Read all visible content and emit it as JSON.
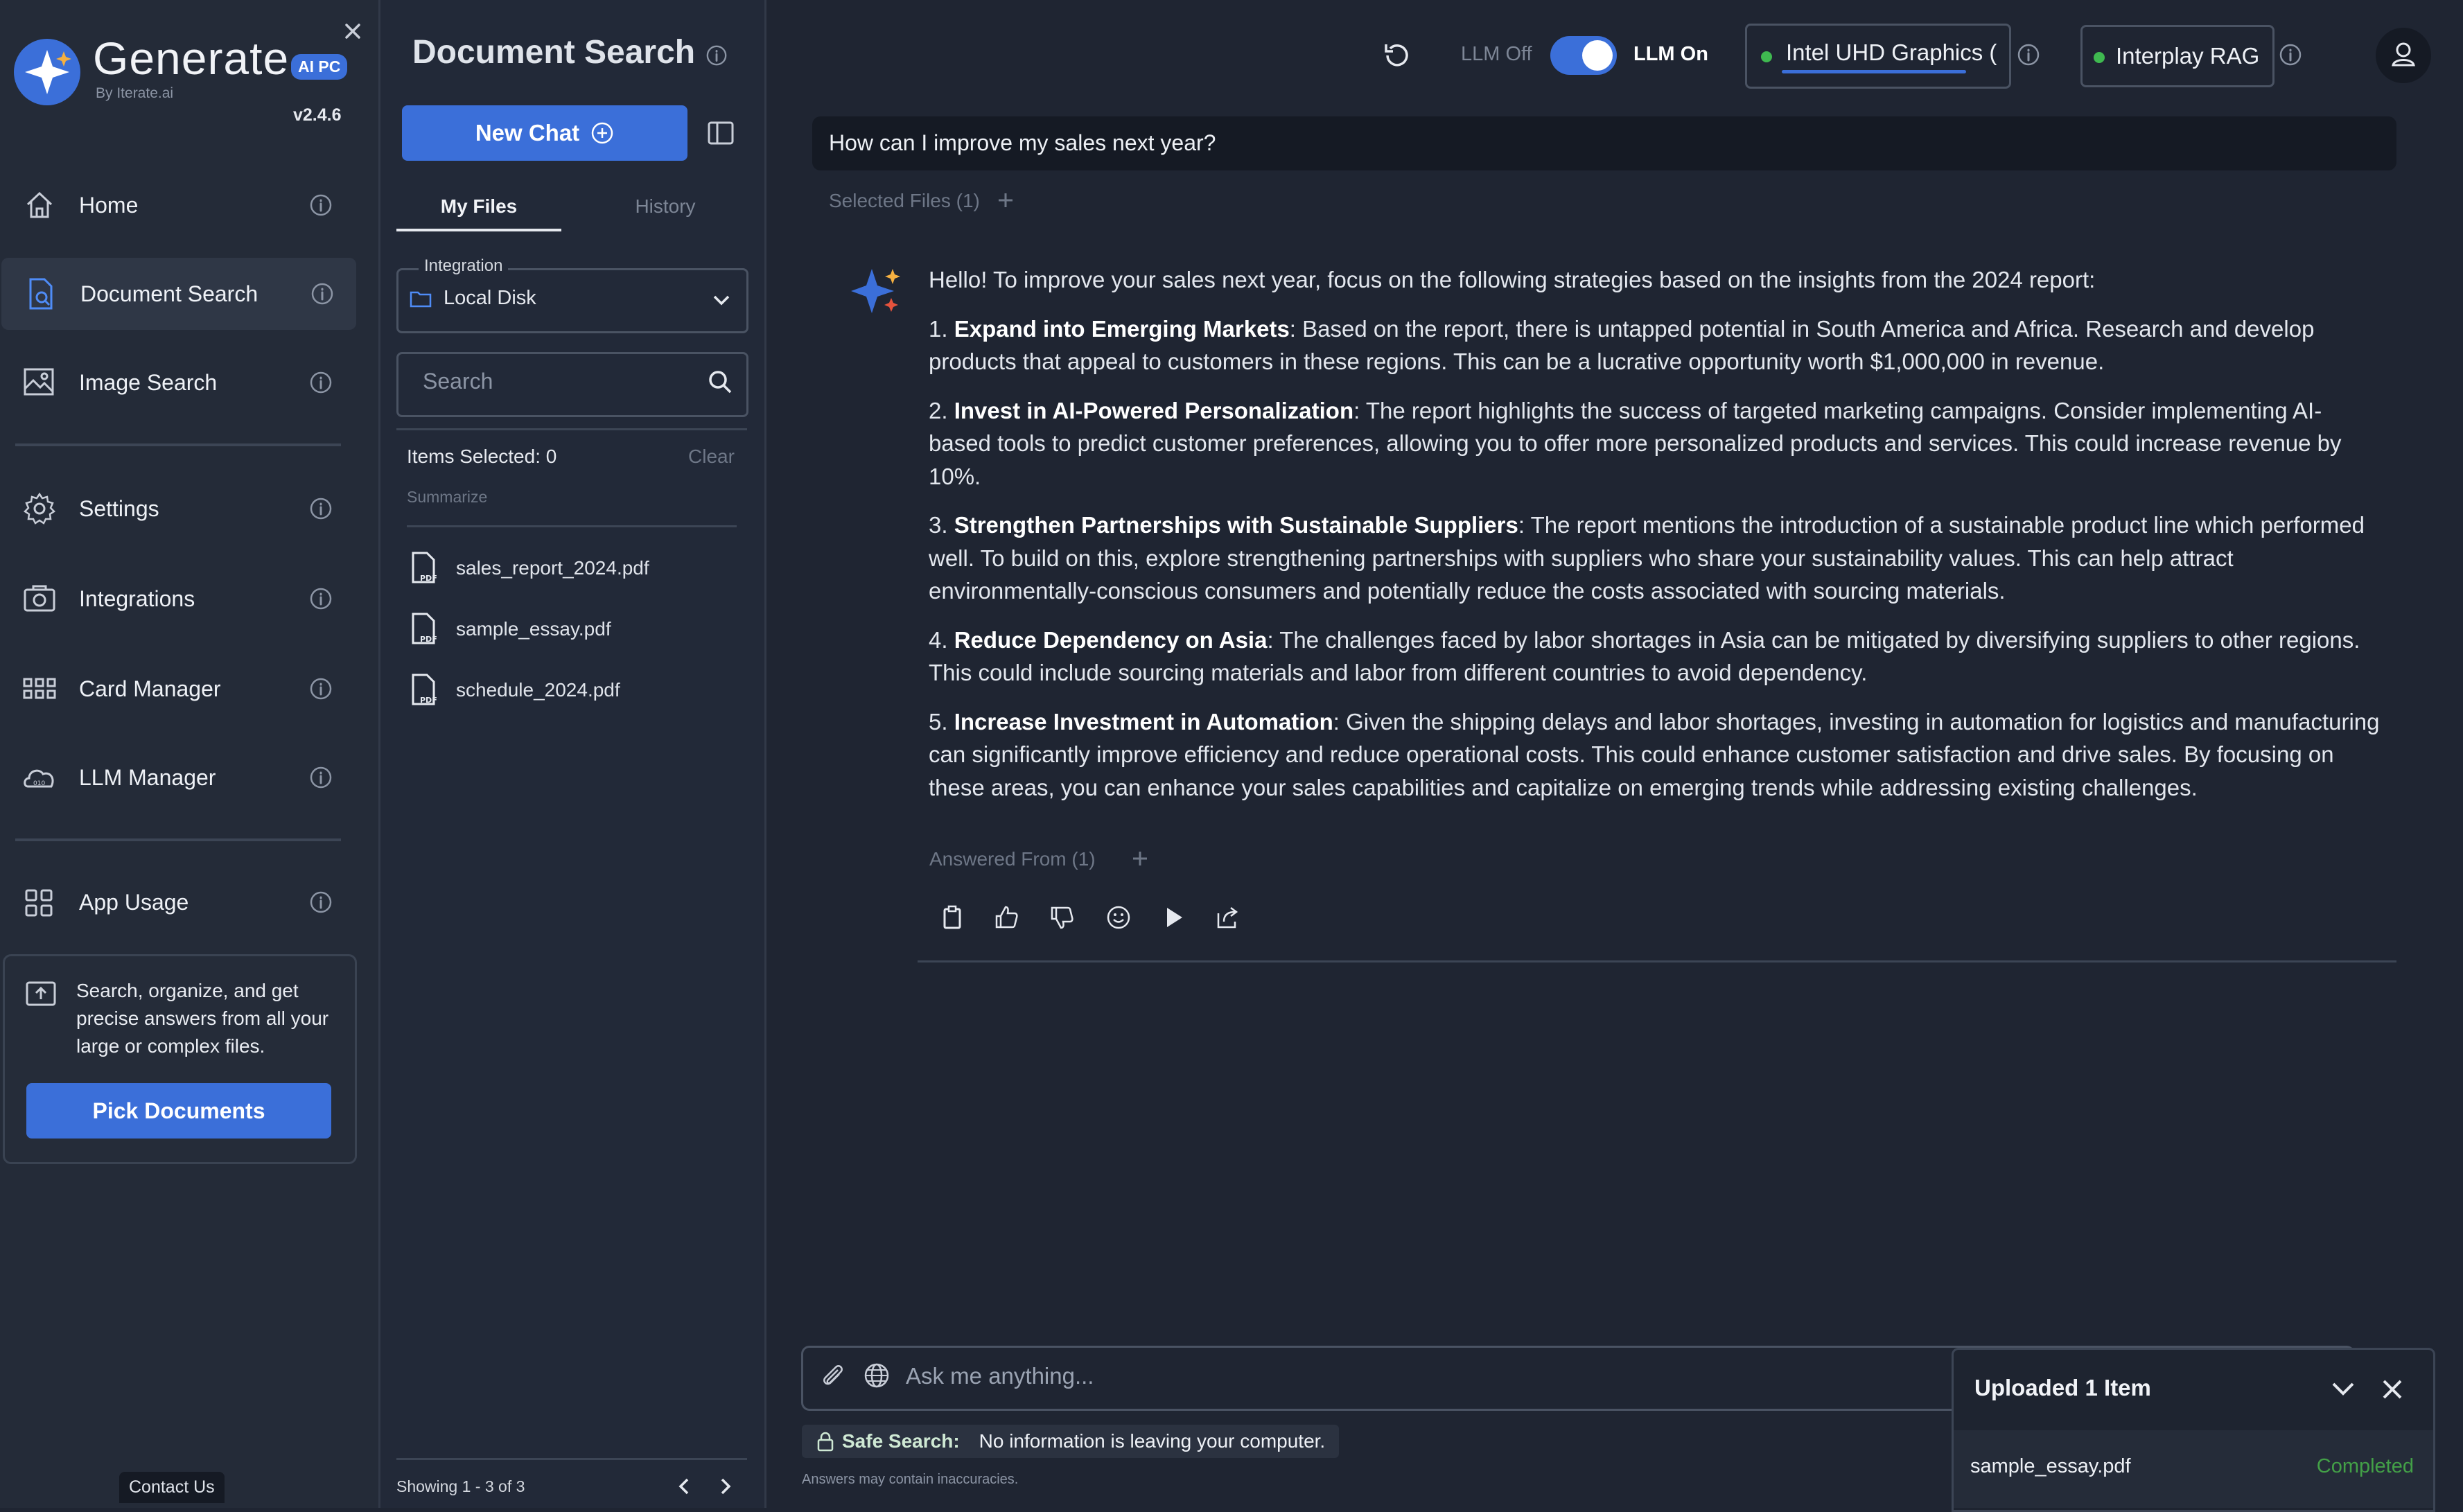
{
  "app": {
    "brand": "Generate",
    "badge": "AI PC",
    "byline": "By Iterate.ai",
    "version": "v2.4.6"
  },
  "sidebar": {
    "items": [
      {
        "label": "Home",
        "icon": "home-icon"
      },
      {
        "label": "Document Search",
        "icon": "document-search-icon"
      },
      {
        "label": "Image Search",
        "icon": "image-search-icon"
      },
      {
        "label": "Settings",
        "icon": "gear-icon"
      },
      {
        "label": "Integrations",
        "icon": "integrations-icon"
      },
      {
        "label": "Card Manager",
        "icon": "grid-icon"
      },
      {
        "label": "LLM Manager",
        "icon": "llm-icon"
      },
      {
        "label": "App Usage",
        "icon": "app-usage-icon"
      }
    ],
    "promo_text": "Search, organize, and get precise answers from all your large or complex files.",
    "promo_button": "Pick Documents",
    "contact": "Contact Us"
  },
  "header": {
    "title": "Document Search",
    "llm_off": "LLM Off",
    "llm_on": "LLM On",
    "llm_enabled": true,
    "device": "Intel UHD Graphics (",
    "rag": "Interplay RAG"
  },
  "files": {
    "new_chat": "New Chat",
    "tabs": [
      "My Files",
      "History"
    ],
    "integration_label": "Integration",
    "integration_value": "Local Disk",
    "search_placeholder": "Search",
    "items_selected": "Items Selected: 0",
    "clear": "Clear",
    "summarize": "Summarize",
    "list": [
      "sales_report_2024.pdf",
      "sample_essay.pdf",
      "schedule_2024.pdf"
    ],
    "pagination": "Showing 1 - 3 of 3"
  },
  "chat": {
    "question": "How can I improve my sales next year?",
    "selected_files": "Selected Files (1)",
    "intro": "Hello! To improve your sales next year, focus on the following strategies based on the insights from the 2024 report:",
    "points": [
      {
        "num": "1. ",
        "title": "Expand into Emerging Markets",
        "text": ": Based on the report, there is untapped potential in South America and Africa. Research and develop products that appeal to customers in these regions. This can be a lucrative opportunity worth $1,000,000 in revenue."
      },
      {
        "num": "2. ",
        "title": "Invest in AI-Powered Personalization",
        "text": ": The report highlights the success of targeted marketing campaigns. Consider implementing AI-based tools to predict customer preferences, allowing you to offer more personalized products and services. This could increase revenue by 10%."
      },
      {
        "num": "3. ",
        "title": "Strengthen Partnerships with Sustainable Suppliers",
        "text": ": The report mentions the introduction of a sustainable product line which performed well. To build on this, explore strengthening partnerships with suppliers who share your sustainability values. This can help attract environmentally-conscious consumers and potentially reduce the costs associated with sourcing materials."
      },
      {
        "num": "4. ",
        "title": "Reduce Dependency on Asia",
        "text": ": The challenges faced by labor shortages in Asia can be mitigated by diversifying suppliers to other regions. This could include sourcing materials and labor from different countries to avoid dependency."
      },
      {
        "num": "5. ",
        "title": "Increase Investment in Automation",
        "text": ": Given the shipping delays and labor shortages, investing in automation for logistics and manufacturing can significantly improve efficiency and reduce operational costs. This could enhance customer satisfaction and drive sales. By focusing on these areas, you can enhance your sales capabilities and capitalize on emerging trends while addressing existing challenges."
      }
    ],
    "answered_from": "Answered From (1)",
    "input_placeholder": "Ask me anything...",
    "safe_label": "Safe Search:",
    "safe_text": "No information is leaving your computer.",
    "disclaimer": "Answers may contain inaccuracies."
  },
  "toast": {
    "title": "Uploaded 1 Item",
    "file": "sample_essay.pdf",
    "status": "Completed"
  },
  "colors": {
    "accent": "#3b6fd9",
    "status_green": "#3fb950",
    "completed": "#43a047"
  }
}
